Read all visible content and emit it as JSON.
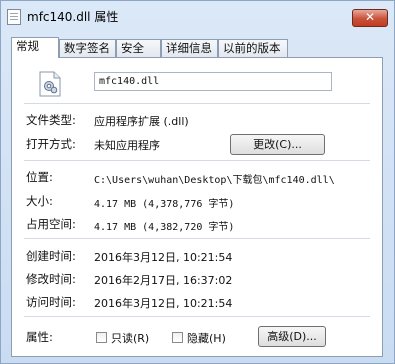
{
  "window": {
    "title": "mfc140.dll 属性",
    "close_label": "✕"
  },
  "tabs": [
    "常规",
    "数字签名",
    "安全",
    "详细信息",
    "以前的版本"
  ],
  "general": {
    "file_name": "mfc140.dll",
    "file_type_label": "文件类型:",
    "file_type_value": "应用程序扩展 (.dll)",
    "open_with_label": "打开方式:",
    "open_with_value": "未知应用程序",
    "change_button": "更改(C)...",
    "location_label": "位置:",
    "location_value": "C:\\Users\\wuhan\\Desktop\\下载包\\mfc140.dll\\",
    "size_label": "大小:",
    "size_value": "4.17 MB (4,378,776 字节)",
    "size_on_disk_label": "占用空间:",
    "size_on_disk_value": "4.17 MB (4,382,720 字节)",
    "created_label": "创建时间:",
    "created_value": "2016年3月12日, 10:21:54",
    "modified_label": "修改时间:",
    "modified_value": "2016年2月17日, 16:37:02",
    "accessed_label": "访问时间:",
    "accessed_value": "2016年3月12日, 10:21:54",
    "attributes_label": "属性:",
    "readonly_label": "只读(R)",
    "hidden_label": "隐藏(H)",
    "advanced_button": "高级(D)..."
  }
}
